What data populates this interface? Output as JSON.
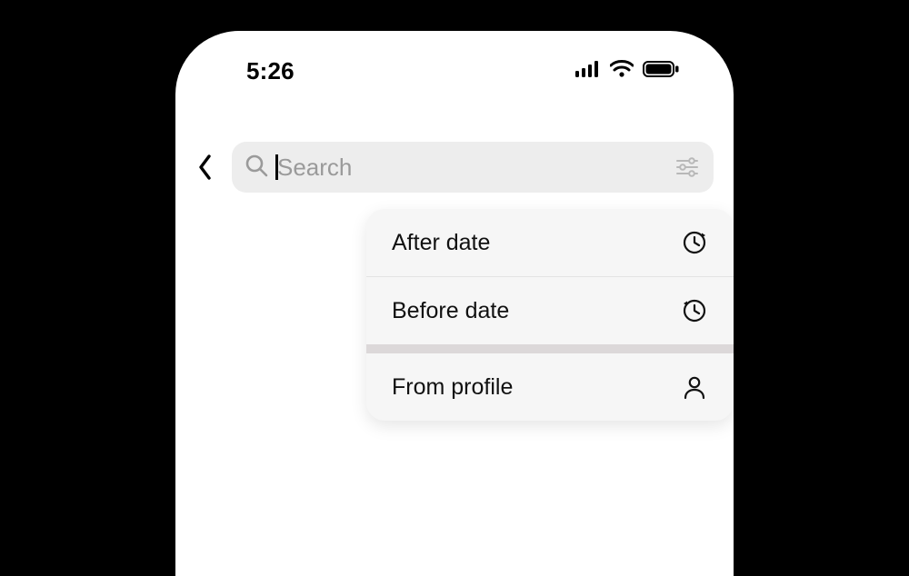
{
  "status_bar": {
    "time": "5:26"
  },
  "search": {
    "placeholder": "Search",
    "value": ""
  },
  "filter_menu": {
    "items": [
      {
        "label": "After date",
        "icon": "clock-forward-icon"
      },
      {
        "label": "Before date",
        "icon": "clock-back-icon"
      },
      {
        "label": "From profile",
        "icon": "person-icon"
      }
    ]
  }
}
